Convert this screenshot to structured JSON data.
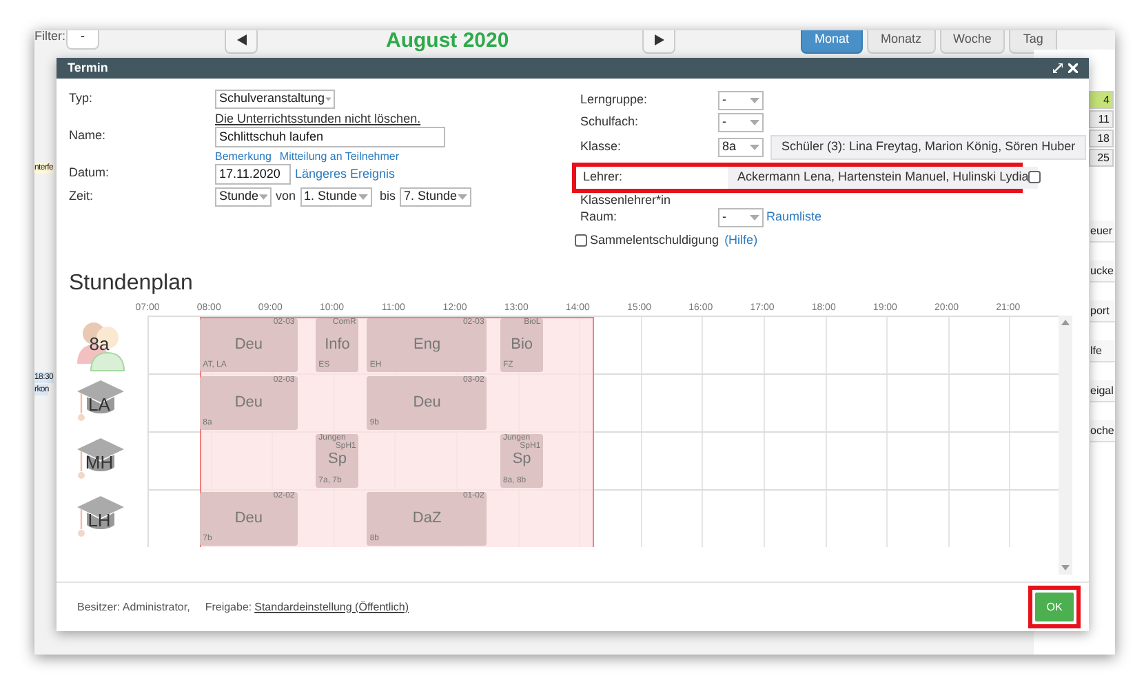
{
  "background": {
    "filter_label": "Filter:",
    "filter_value": "-",
    "month_title": "August 2020",
    "view_buttons": [
      {
        "label": "Monat",
        "selected": true
      },
      {
        "label": "Monatz",
        "selected": false
      },
      {
        "label": "Woche",
        "selected": false
      },
      {
        "label": "Tag",
        "selected": false
      }
    ],
    "mini_calendar": {
      "days": [
        {
          "label": "4",
          "selected": true
        },
        {
          "label": "11",
          "selected": false
        },
        {
          "label": "18",
          "selected": false
        },
        {
          "label": "25",
          "selected": false
        }
      ]
    },
    "side_items": [
      "euer",
      "ucke",
      "port",
      "lfe",
      "eigal",
      "oche"
    ],
    "left_fragments": [
      {
        "text": "nterfe",
        "color": "#fff7d6"
      },
      {
        "text": "18:30",
        "color": "#dbe7f5"
      },
      {
        "text": "rkon",
        "color": "#dbe7f5"
      }
    ]
  },
  "dialog": {
    "title": "Termin",
    "left_fields": [
      {
        "kind": "select",
        "label": "Typ:",
        "value": "Schulveranstaltung",
        "note": "Die Unterrichtsstunden nicht löschen."
      },
      {
        "kind": "input",
        "label": "Name:",
        "value": "Schlittschuh laufen",
        "links": [
          "Bemerkung",
          "Mitteilung an Teilnehmer"
        ]
      },
      {
        "kind": "date",
        "label": "Datum:",
        "value": "17.11.2020",
        "links": [
          "Längeres Ereignis"
        ]
      },
      {
        "kind": "time",
        "label": "Zeit:",
        "unit": "Stunde",
        "from_label": "von",
        "from": "1. Stunde",
        "to_label": "bis",
        "to": "7. Stunde"
      }
    ],
    "right_fields": [
      {
        "kind": "select",
        "label": "Lerngruppe:",
        "value": "-"
      },
      {
        "kind": "select",
        "label": "Schulfach:",
        "value": "-"
      },
      {
        "kind": "class",
        "label": "Klasse:",
        "value": "8a",
        "info": "Schüler (3): Lina Freytag, Marion König, Sören Huber"
      },
      {
        "kind": "teachers",
        "label": "Lehrer:",
        "value": "Ackermann Lena, Hartenstein Manuel, Hulinski Lydia",
        "checked": false,
        "highlighted": true,
        "sub_label": "Klassenlehrer*in"
      },
      {
        "kind": "room",
        "label": "Raum:",
        "value": "-",
        "link": "Raumliste"
      },
      {
        "kind": "checkbox",
        "caption": "Sammelentschuldigung",
        "checked": false,
        "link": "(Hilfe)"
      }
    ],
    "timetable": {
      "title": "Stundenplan",
      "hours": [
        "07:00",
        "08:00",
        "09:00",
        "10:00",
        "11:00",
        "12:00",
        "13:00",
        "14:00",
        "15:00",
        "16:00",
        "17:00",
        "18:00",
        "19:00",
        "20:00",
        "21:00"
      ],
      "rows": [
        {
          "kind": "class",
          "label": "8a",
          "lessons": [
            {
              "subject": "Deu",
              "room": "02-03",
              "participants": "AT, LA"
            },
            {
              "subject": "Info",
              "room": "ComR",
              "participants": "ES"
            },
            {
              "subject": "Eng",
              "room": "02-03",
              "participants": "EH"
            },
            {
              "subject": "Bio",
              "room": "BioL",
              "participants": "FZ"
            }
          ]
        },
        {
          "kind": "teacher",
          "label": "LA",
          "lessons": [
            {
              "subject": "Deu",
              "room": "02-03",
              "participants": "8a"
            },
            {
              "subject": "Deu",
              "room": "03-02",
              "participants": "9b"
            }
          ]
        },
        {
          "kind": "teacher",
          "label": "MH",
          "lessons": [
            {
              "subject": "Sp",
              "group": "Jungen",
              "room": "SpH1",
              "participants": "7a, 7b"
            },
            {
              "subject": "Sp",
              "group": "Jungen",
              "room": "SpH1",
              "participants": "8a, 8b"
            }
          ]
        },
        {
          "kind": "teacher",
          "label": "LH",
          "lessons": [
            {
              "subject": "Deu",
              "room": "02-02",
              "participants": "7b"
            },
            {
              "subject": "DaZ",
              "room": "01-02",
              "participants": "8b"
            }
          ]
        }
      ]
    },
    "footer": {
      "owner": "Besitzer: Administrator,",
      "share_label": "Freigabe:",
      "share_link": "Standardeinstellung (Öffentlich)"
    },
    "ok_button": {
      "label": "OK",
      "highlighted": true
    }
  }
}
